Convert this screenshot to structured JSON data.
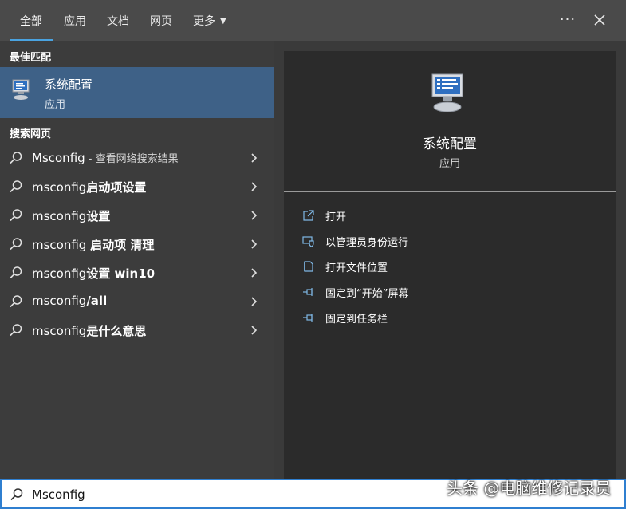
{
  "tabs": [
    {
      "label": "全部"
    },
    {
      "label": "应用"
    },
    {
      "label": "文档"
    },
    {
      "label": "网页"
    },
    {
      "label": "更多"
    }
  ],
  "toolbar": {
    "more_icon": "more-options-icon",
    "close_icon": "close-icon"
  },
  "left": {
    "best_match_header": "最佳匹配",
    "best_match": {
      "title": "系统配置",
      "subtitle": "应用",
      "icon": "system-config-icon"
    },
    "web_header": "搜索网页",
    "results": [
      {
        "text": "Msconfig",
        "bold": "",
        "hint": " - 查看网络搜索结果"
      },
      {
        "text": "msconfig",
        "bold": "启动项设置",
        "hint": ""
      },
      {
        "text": "msconfig",
        "bold": "设置",
        "hint": ""
      },
      {
        "text": "msconfig ",
        "bold": "启动项 清理",
        "hint": ""
      },
      {
        "text": "msconfig",
        "bold": "设置 win10",
        "hint": ""
      },
      {
        "text": "msconfig",
        "bold": "/all",
        "hint": ""
      },
      {
        "text": "msconfig",
        "bold": "是什么意思",
        "hint": ""
      }
    ]
  },
  "preview": {
    "title": "系统配置",
    "subtitle": "应用",
    "actions": [
      {
        "label": "打开",
        "icon": "open-icon"
      },
      {
        "label": "以管理员身份运行",
        "icon": "shield-icon"
      },
      {
        "label": "打开文件位置",
        "icon": "file-location-icon"
      },
      {
        "label": "固定到“开始”屏幕",
        "icon": "pin-icon"
      },
      {
        "label": "固定到任务栏",
        "icon": "pin-icon"
      }
    ]
  },
  "search": {
    "value": "Msconfig"
  },
  "watermark": "头条 @电脑维修记录员",
  "colors": {
    "accent": "#4aa3e0",
    "selected": "#3e6187",
    "panel": "#2b2b2b"
  }
}
